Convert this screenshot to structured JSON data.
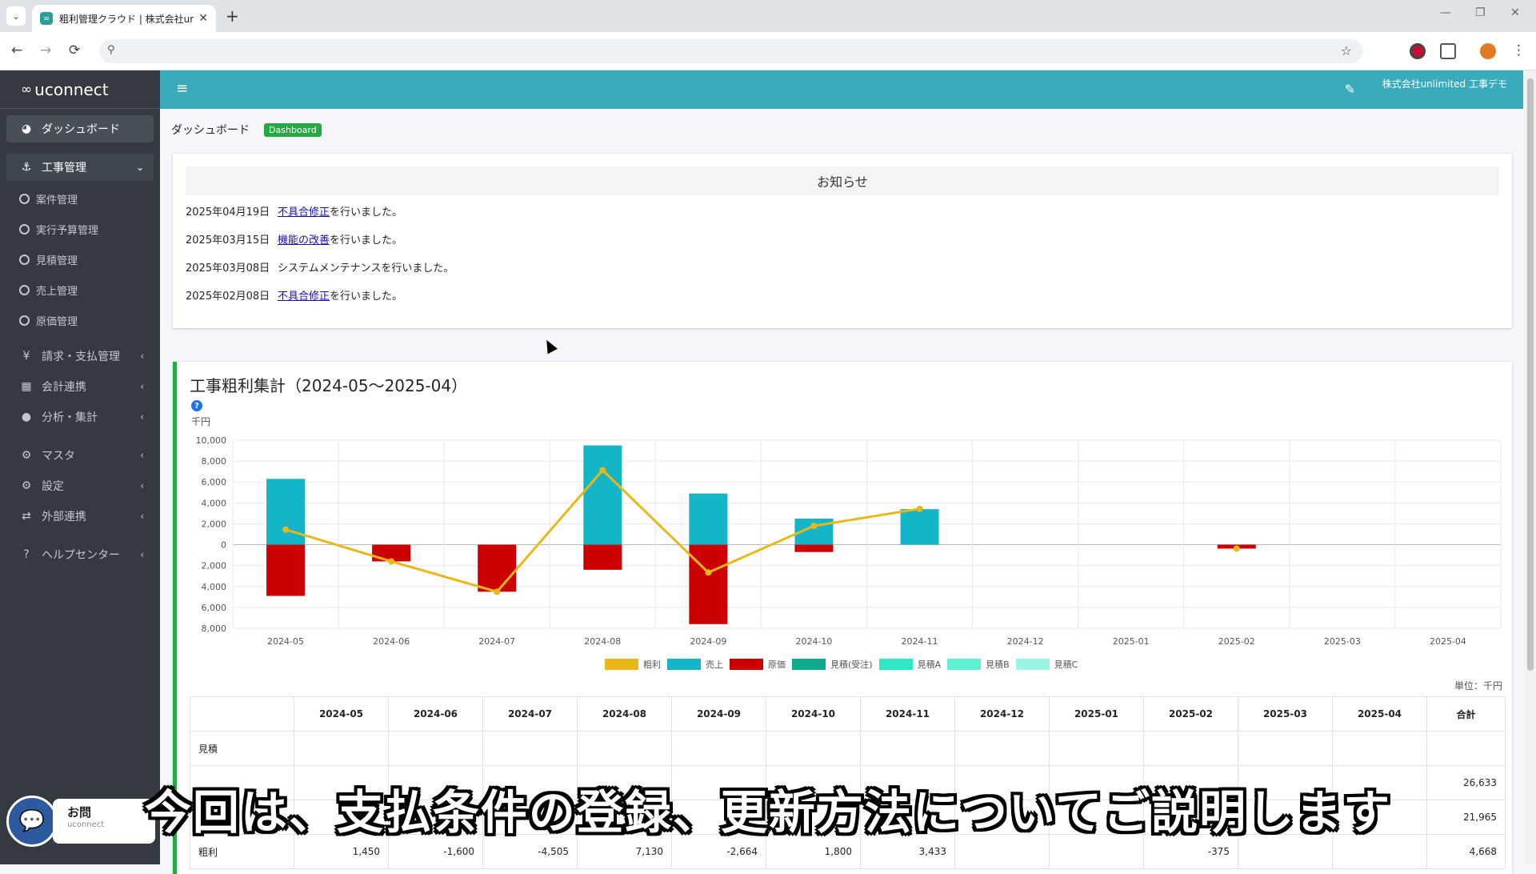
{
  "browser": {
    "tab_title": "粗利管理クラウド | 株式会社unlim",
    "tab_close": "✕",
    "new_tab": "+",
    "dropdown": "⌄",
    "back": "←",
    "forward": "→",
    "reload": "⟳",
    "star": "☆"
  },
  "sidebar": {
    "brand": "uconnect",
    "items": [
      {
        "label": "ダッシュボード",
        "icon": "tachometer-icon",
        "glyph": "◕"
      },
      {
        "label": "工事管理",
        "icon": "anchor-icon",
        "glyph": "⚓",
        "arrow": "⌄"
      },
      {
        "label": "請求・支払管理",
        "icon": "yen-icon",
        "glyph": "¥",
        "arrow": "‹"
      },
      {
        "label": "会計連携",
        "icon": "calculator-icon",
        "glyph": "▦",
        "arrow": "‹"
      },
      {
        "label": "分析・集計",
        "icon": "droplet-icon",
        "glyph": "●",
        "arrow": "‹"
      },
      {
        "label": "マスタ",
        "icon": "gear-icon",
        "glyph": "⚙",
        "arrow": "‹"
      },
      {
        "label": "設定",
        "icon": "gears-icon",
        "glyph": "⚙",
        "arrow": "‹"
      },
      {
        "label": "外部連携",
        "icon": "exchange-icon",
        "glyph": "⇄",
        "arrow": "‹"
      },
      {
        "label": "ヘルプセンター",
        "icon": "question-icon",
        "glyph": "?",
        "arrow": "‹"
      }
    ],
    "sub_items": [
      "案件管理",
      "実行予算管理",
      "見積管理",
      "売上管理",
      "原価管理"
    ],
    "chat_label": "お問",
    "chat_sub": "uconnect"
  },
  "header": {
    "menu": "≡",
    "edit": "✎",
    "company": "株式会社unlimited 工事デモ"
  },
  "breadcrumb": {
    "title": "ダッシュボード",
    "badge": "Dashboard"
  },
  "notice": {
    "heading": "お知らせ",
    "rows": [
      {
        "date": "2025年04月19日",
        "link": "不具合修正",
        "text": "を行いました。"
      },
      {
        "date": "2025年03月15日",
        "link": "機能の改善",
        "text": "を行いました。"
      },
      {
        "date": "2025年03月08日",
        "link": "",
        "text": "システムメンテナンスを行いました。"
      },
      {
        "date": "2025年02月08日",
        "link": "不具合修正",
        "text": "を行いました。"
      }
    ]
  },
  "profit": {
    "title": "工事粗利集計（2024-05～2025-04）",
    "help": "?",
    "unit_label": "千円",
    "table_unit": "単位：千円",
    "table_headers": [
      "",
      "2024-05",
      "2024-06",
      "2024-07",
      "2024-08",
      "2024-09",
      "2024-10",
      "2024-11",
      "2024-12",
      "2025-01",
      "2025-02",
      "2025-03",
      "2025-04",
      "合計"
    ],
    "table_rows": [
      {
        "label": "見積",
        "cells": [
          "",
          "",
          "",
          "",
          "",
          "",
          "",
          "",
          "",
          "",
          "",
          "",
          ""
        ]
      },
      {
        "label": "",
        "cells": [
          "",
          "",
          "",
          "",
          "",
          "",
          "",
          "",
          "",
          "",
          "",
          "",
          "26,633"
        ]
      },
      {
        "label": "",
        "cells": [
          "",
          "",
          "",
          "",
          "",
          "",
          "",
          "",
          "",
          "",
          "",
          "",
          "21,965"
        ]
      },
      {
        "label": "粗利",
        "cells": [
          "1,450",
          "-1,600",
          "-4,505",
          "7,130",
          "-2,664",
          "1,800",
          "3,433",
          "",
          "",
          "-375",
          "",
          "",
          "4,668"
        ]
      }
    ]
  },
  "chart_data": {
    "type": "bar",
    "categories": [
      "2024-05",
      "2024-06",
      "2024-07",
      "2024-08",
      "2024-09",
      "2024-10",
      "2024-11",
      "2024-12",
      "2025-01",
      "2025-02",
      "2025-03",
      "2025-04"
    ],
    "ylim": [
      -8000,
      10000
    ],
    "yticks": [
      10000,
      8000,
      6000,
      4000,
      2000,
      0,
      -2000,
      -4000,
      -6000,
      -8000
    ],
    "ytick_labels": [
      "10,000",
      "8,000",
      "6,000",
      "4,000",
      "2,000",
      "0",
      "2,000",
      "4,000",
      "6,000",
      "8,000"
    ],
    "series": [
      {
        "name": "粗利",
        "type": "line",
        "color": "#e8b81a",
        "values": [
          1450,
          -1600,
          -4505,
          7130,
          -2664,
          1800,
          3433,
          null,
          null,
          -375,
          null,
          null
        ]
      },
      {
        "name": "売上",
        "type": "bar",
        "color": "#13b5c7",
        "values": [
          6300,
          0,
          0,
          9500,
          4900,
          2500,
          3400,
          0,
          0,
          0,
          0,
          0
        ]
      },
      {
        "name": "原価",
        "type": "bar",
        "color": "#cc0000",
        "values": [
          -4900,
          -1600,
          -4500,
          -2400,
          -7600,
          -700,
          0,
          0,
          0,
          -375,
          0,
          0
        ]
      },
      {
        "name": "見積(受注)",
        "type": "bar",
        "color": "#12a88e",
        "values": []
      },
      {
        "name": "見積A",
        "type": "bar",
        "color": "#2ee8c4",
        "values": []
      },
      {
        "name": "見積B",
        "type": "bar",
        "color": "#5ef0d2",
        "values": []
      },
      {
        "name": "見積C",
        "type": "bar",
        "color": "#9af5e5",
        "values": []
      }
    ],
    "grid": true,
    "legend": "bottom"
  },
  "caption": "今回は、支払条件の登録、更新方法についてご説明します"
}
